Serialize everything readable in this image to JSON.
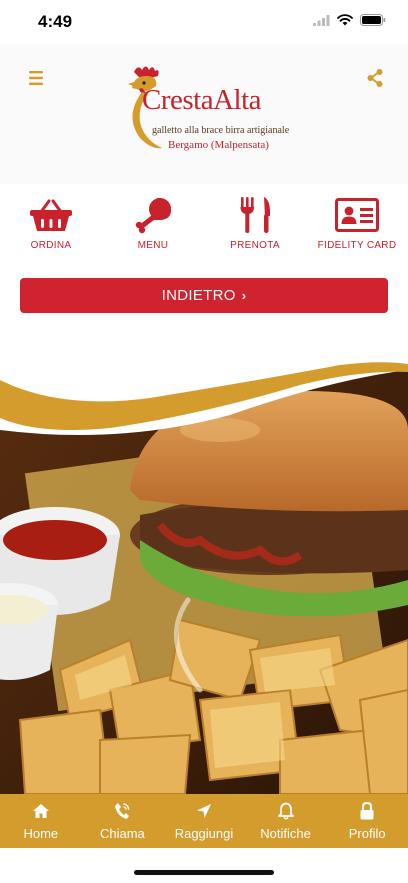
{
  "status": {
    "time": "4:49"
  },
  "brand": {
    "name": "CrestaAlta",
    "tagline": "galletto alla brace birra artigianale",
    "location": "Bergamo (Malpensata)",
    "accent_red": "#c8222c",
    "accent_gold": "#d49c2d"
  },
  "header": {
    "menu_icon": "hamburger-icon",
    "share_icon": "share-icon"
  },
  "quick_actions": [
    {
      "label": "ORDINA",
      "icon": "basket-icon"
    },
    {
      "label": "MENU",
      "icon": "chicken-leg-icon"
    },
    {
      "label": "PRENOTA",
      "icon": "fork-knife-icon"
    },
    {
      "label": "FIDELITY CARD",
      "icon": "id-card-icon"
    }
  ],
  "back_button": {
    "label": "INDIETRO"
  },
  "tabbar": [
    {
      "label": "Home",
      "icon": "home-icon"
    },
    {
      "label": "Chiama",
      "icon": "phone-icon"
    },
    {
      "label": "Raggiungi",
      "icon": "navigation-arrow-icon"
    },
    {
      "label": "Notifiche",
      "icon": "bell-icon"
    },
    {
      "label": "Profilo",
      "icon": "lock-icon"
    }
  ]
}
